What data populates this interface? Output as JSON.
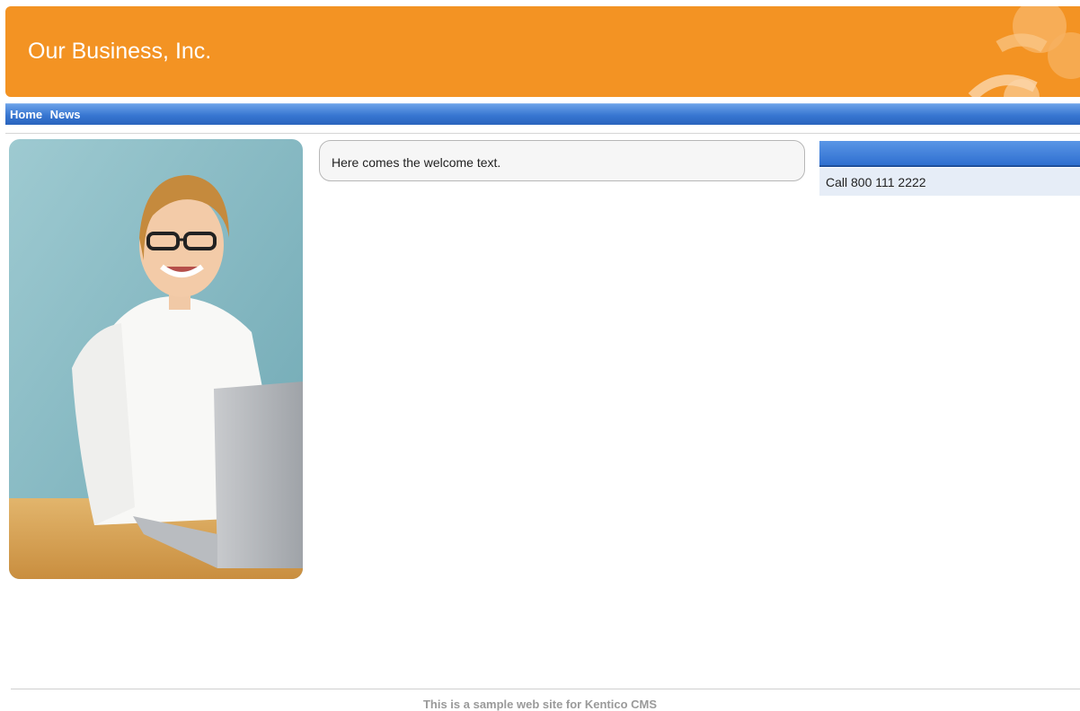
{
  "header": {
    "title": "Our Business, Inc."
  },
  "nav": {
    "items": [
      {
        "label": "Home"
      },
      {
        "label": "News"
      }
    ]
  },
  "welcome": {
    "text": "Here comes the welcome text."
  },
  "sidebar": {
    "title": "",
    "text": "Call 800 111 2222"
  },
  "footer": {
    "text": "This is a sample web site for Kentico CMS"
  },
  "colors": {
    "header": "#f39323",
    "nav": "#3776d1",
    "sidebar_bg": "#e6edf7"
  },
  "image": {
    "subject": "woman-with-laptop-photo"
  }
}
